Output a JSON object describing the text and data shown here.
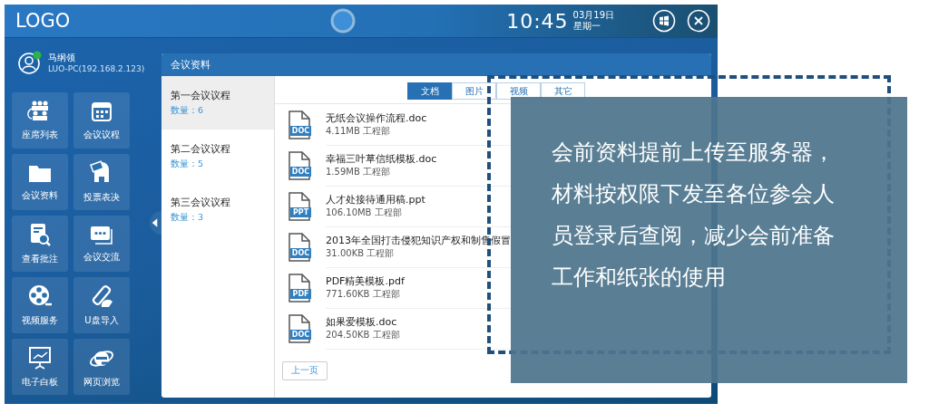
{
  "header": {
    "logo": "LOGO",
    "time": "10:45",
    "date": "03月19日",
    "weekday": "星期一"
  },
  "user": {
    "name": "马纲领",
    "host": "LUO-PC(192.168.2.123)",
    "online": true
  },
  "menu": [
    {
      "label": "座席列表"
    },
    {
      "label": "会议议程"
    },
    {
      "label": "会议资料"
    },
    {
      "label": "投票表决"
    },
    {
      "label": "查看批注"
    },
    {
      "label": "会议交流"
    },
    {
      "label": "视频服务"
    },
    {
      "label": "U盘导入"
    },
    {
      "label": "电子白板"
    },
    {
      "label": "网页浏览"
    }
  ],
  "panel": {
    "title": "会议资料",
    "agendas": [
      {
        "title": "第一会议议程",
        "count": "数量：6",
        "selected": true
      },
      {
        "title": "第二会议议程",
        "count": "数量：5",
        "selected": false
      },
      {
        "title": "第三会议议程",
        "count": "数量：3",
        "selected": false
      }
    ],
    "tabs": [
      {
        "label": "文档",
        "selected": true
      },
      {
        "label": "图片",
        "selected": false
      },
      {
        "label": "视频",
        "selected": false
      },
      {
        "label": "其它",
        "selected": false
      }
    ],
    "files": [
      {
        "name": "无纸会议操作流程.doc",
        "meta": "4.11MB 工程部",
        "badge": "DOC"
      },
      {
        "name": "幸福三叶草信纸模板.doc",
        "meta": "1.59MB 工程部",
        "badge": "DOC"
      },
      {
        "name": "人才处接待通用稿.ppt",
        "meta": "106.10MB 工程部",
        "badge": "PPT"
      },
      {
        "name": "2013年全国打击侵犯知识产权和制售假冒",
        "meta": "31.00KB 工程部",
        "badge": "DOC"
      },
      {
        "name": "PDF精美模板.pdf",
        "meta": "771.60KB 工程部",
        "badge": "PDF"
      },
      {
        "name": "如果爱模板.doc",
        "meta": "204.50KB 工程部",
        "badge": "DOC"
      }
    ],
    "prev_page": "上一页"
  },
  "callout": {
    "text": "会前资料提前上传至服务器，材料按权限下发至各位参会人员登录后查阅，减少会前准备工作和纸张的使用"
  }
}
